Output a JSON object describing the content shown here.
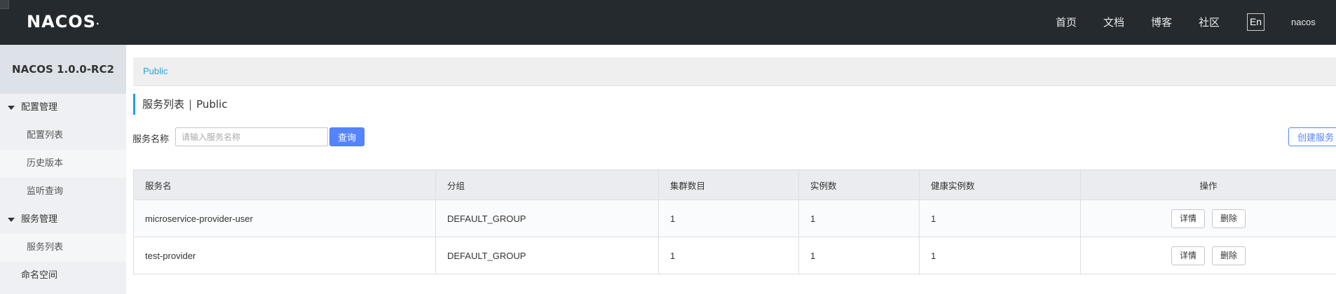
{
  "header": {
    "logo": "NACOS",
    "logo_dot": ".",
    "nav": [
      "首页",
      "文档",
      "博客",
      "社区"
    ],
    "lang": "En",
    "user": "nacos"
  },
  "sidebar": {
    "title": "NACOS 1.0.0-RC2",
    "groups": [
      {
        "label": "配置管理",
        "items": [
          "配置列表",
          "历史版本",
          "监听查询"
        ]
      },
      {
        "label": "服务管理",
        "items": [
          "服务列表"
        ]
      }
    ],
    "namespace": "命名空间"
  },
  "namespace_bar": {
    "current": "Public"
  },
  "page": {
    "title": "服务列表",
    "separator": "|",
    "namespace": "Public"
  },
  "search": {
    "label": "服务名称",
    "placeholder": "请输入服务名称",
    "value": "",
    "query_button": "查询",
    "create_button": "创建服务"
  },
  "table": {
    "columns": [
      "服务名",
      "分组",
      "集群数目",
      "实例数",
      "健康实例数",
      "操作"
    ],
    "rows": [
      {
        "service": "microservice-provider-user",
        "group": "DEFAULT_GROUP",
        "clusters": "1",
        "instances": "1",
        "healthy": "1"
      },
      {
        "service": "test-provider",
        "group": "DEFAULT_GROUP",
        "clusters": "1",
        "instances": "1",
        "healthy": "1"
      }
    ],
    "actions": {
      "detail": "详情",
      "delete": "删除"
    }
  }
}
